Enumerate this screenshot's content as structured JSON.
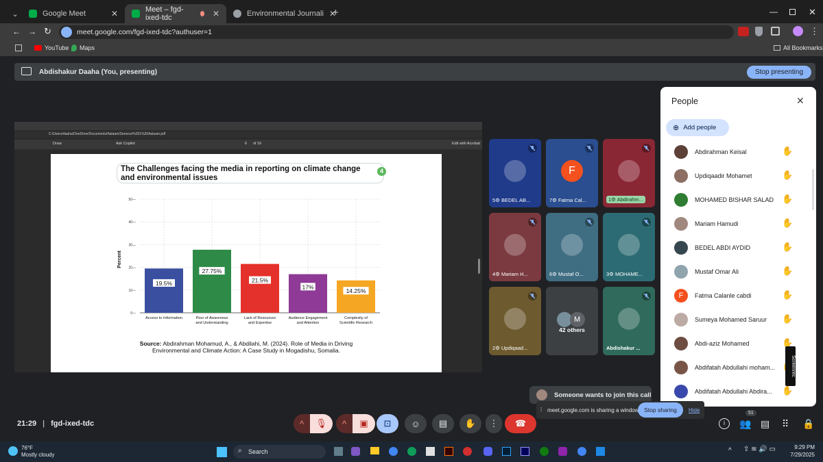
{
  "browser": {
    "tabs": [
      {
        "label": "Google Meet"
      },
      {
        "label": "Meet – fgd-ixed-tdc"
      },
      {
        "label": "Environmental Journalism Evol"
      }
    ],
    "url": "meet.google.com/fgd-ixed-tdc?authuser=1",
    "bookmarks": [
      "YouTube",
      "Maps"
    ],
    "all_bookmarks": "All Bookmarks"
  },
  "meet": {
    "presenting_label": "Abdishakur Daaha (You, presenting)",
    "stop_presenting": "Stop presenting",
    "time": "21:29",
    "meeting_code": "fgd-ixed-tdc",
    "join_request": "Someone wants to join this call",
    "sharing_notice": "meet.google.com is sharing a window.",
    "stop_sharing": "Stop sharing",
    "hide": "Hide",
    "participant_count_badge": "51"
  },
  "pdf": {
    "path": "C:/Users/daaha/OneDrive/Documents/Aalaam/Seesoor%201%20Aalaam.pdf",
    "page": "6",
    "of_pages": "of 16",
    "draw": "Draw",
    "ask_copilot": "Ask Copilot",
    "edit_acrobat": "Edit with Acrobat"
  },
  "slide": {
    "title_line1": "The Challenges facing the media in reporting on climate change",
    "title_line2": "and environmental issues",
    "page_badge": "4",
    "source_bold": "Source:",
    "source_line1": "Abdirahman Mohamud, A., & Abdilahi, M. (2024). Role of Media in Driving",
    "source_line2": "Environmental and Climate Action: A Case Study in Mogadishu, Somalia."
  },
  "chart_data": {
    "type": "bar",
    "categories": [
      "Access to Information",
      "Poor of Awareness and Understanding",
      "Lack of Resources and Expertise",
      "Audience Engagement and Attention",
      "Complexity of Scientific Research"
    ],
    "category_lines": [
      [
        "Access to Information"
      ],
      [
        "Poor of Awareness",
        "and Understanding"
      ],
      [
        "Lack of Resources",
        "and Expertise"
      ],
      [
        "Audience Engagement",
        "and Attention"
      ],
      [
        "Complexity of",
        "Scientific Research"
      ]
    ],
    "values": [
      19.5,
      27.75,
      21.5,
      17,
      14.25
    ],
    "data_labels": [
      "19.5%",
      "27.75%",
      "21.5%",
      "17%",
      "14.25%"
    ],
    "ylabel": "Percent",
    "ylim": [
      0,
      50
    ],
    "yticks": [
      0,
      10,
      20,
      30,
      40,
      50
    ],
    "colors": [
      "#3b4fa0",
      "#2e8b47",
      "#e5312b",
      "#8e3a96",
      "#f5a623"
    ],
    "grid": true
  },
  "tiles": [
    {
      "name": "5⚙ BEDEL AB...",
      "bg": "#1f3b8a"
    },
    {
      "name": "7⚙ Fatma Cal...",
      "bg": "#2a4e8f",
      "letter": "F"
    },
    {
      "name": "1⚙ Abdirahm...",
      "bg": "#8a2734"
    },
    {
      "name": "4⚙ Mariam H...",
      "bg": "#7a3a3f"
    },
    {
      "name": "6⚙ Mustaf O...",
      "bg": "#3f6e83"
    },
    {
      "name": "3⚙ MOHAME...",
      "bg": "#2c6b73"
    },
    {
      "name": "2⚙ Updiqaad...",
      "bg": "#6d5a2f"
    },
    {
      "name": "42 others",
      "bg": "#3c4043",
      "letter": "M"
    },
    {
      "name": "Abdishakur ...",
      "bg": "#2f6a5c"
    }
  ],
  "people": {
    "title": "People",
    "add_people": "Add people",
    "list": [
      "Abdirahman Keisal",
      "Updiqaadir Mohamet",
      "MOHAMED BISHAR SALAD",
      "Mariam Hamudi",
      "BEDEL ABDI AYDID",
      "Mustaf Omar Ali",
      "Fatma Calanle cabdi",
      "Sumeya Mohamed Saruur",
      "Abdi-aziz Mohamed",
      "Abdifatah Abdullahi moham...",
      "Abdifatah Abdullahi Abdira..."
    ],
    "fatma_letter": "F"
  },
  "taskbar": {
    "temp": "76°F",
    "weather": "Mostly cloudy",
    "search": "Search",
    "clock_time": "9:29 PM",
    "clock_date": "7/29/2025"
  },
  "screencast_label": "Screenrec"
}
